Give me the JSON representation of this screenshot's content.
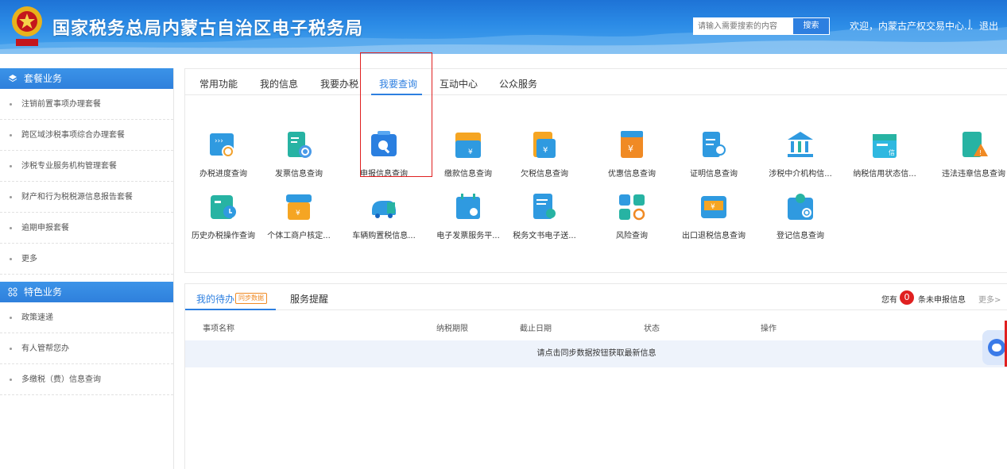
{
  "header": {
    "title": "国家税务总局内蒙古自治区电子税务局",
    "search_placeholder": "请输入需要搜索的内容",
    "search_button": "搜索",
    "welcome": "欢迎，内蒙古产权交易中心...",
    "separator": "|",
    "logout": "退出"
  },
  "sidebar": {
    "section1_title": "套餐业务",
    "section1_items": [
      "注销前置事项办理套餐",
      "跨区域涉税事项综合办理套餐",
      "涉税专业服务机构管理套餐",
      "财产和行为税税源信息报告套餐",
      "逾期申报套餐",
      "更多"
    ],
    "section2_title": "特色业务",
    "section2_items": [
      "政策速递",
      "有人管帮您办",
      "多缴税（费）信息查询"
    ]
  },
  "tabs": [
    "常用功能",
    "我的信息",
    "我要办税",
    "我要查询",
    "互动中心",
    "公众服务"
  ],
  "active_tab": "我要查询",
  "query_items": [
    {
      "label": "办税进度查询",
      "icon": "progress-icon"
    },
    {
      "label": "发票信息查询",
      "icon": "invoice-icon"
    },
    {
      "label": "申报信息查询",
      "icon": "declaration-search-icon"
    },
    {
      "label": "缴款信息查询",
      "icon": "payment-icon"
    },
    {
      "label": "欠税信息查询",
      "icon": "arrears-icon"
    },
    {
      "label": "优惠信息查询",
      "icon": "preferential-icon"
    },
    {
      "label": "证明信息查询",
      "icon": "certificate-icon"
    },
    {
      "label": "涉税中介机构信...",
      "icon": "agency-icon"
    },
    {
      "label": "纳税信用状态信...",
      "icon": "credit-icon"
    },
    {
      "label": "违法违章信息查询",
      "icon": "violation-icon"
    },
    {
      "label": "历史办税操作查询",
      "icon": "history-icon"
    },
    {
      "label": "个体工商户核定...",
      "icon": "business-icon"
    },
    {
      "label": "车辆购置税信息...",
      "icon": "vehicle-icon"
    },
    {
      "label": "电子发票服务平...",
      "icon": "e-invoice-icon"
    },
    {
      "label": "税务文书电子送...",
      "icon": "document-icon"
    },
    {
      "label": "风险查询",
      "icon": "risk-icon"
    },
    {
      "label": "出口退税信息查询",
      "icon": "export-refund-icon"
    },
    {
      "label": "登记信息查询",
      "icon": "registration-icon"
    }
  ],
  "todo": {
    "tab1": "我的待办",
    "sync_badge": "同步数据",
    "tab2": "服务提醒",
    "you_have": "您有",
    "count": "0",
    "unreported": "条未申报信息",
    "more": "更多>",
    "columns": [
      "事项名称",
      "纳税期限",
      "截止日期",
      "状态",
      "操作"
    ],
    "empty_message": "请点击同步数据按钮获取最新信息"
  },
  "colors": {
    "accent": "#2d7fe0",
    "highlight": "#e02020",
    "badge_orange": "#f08a24"
  }
}
